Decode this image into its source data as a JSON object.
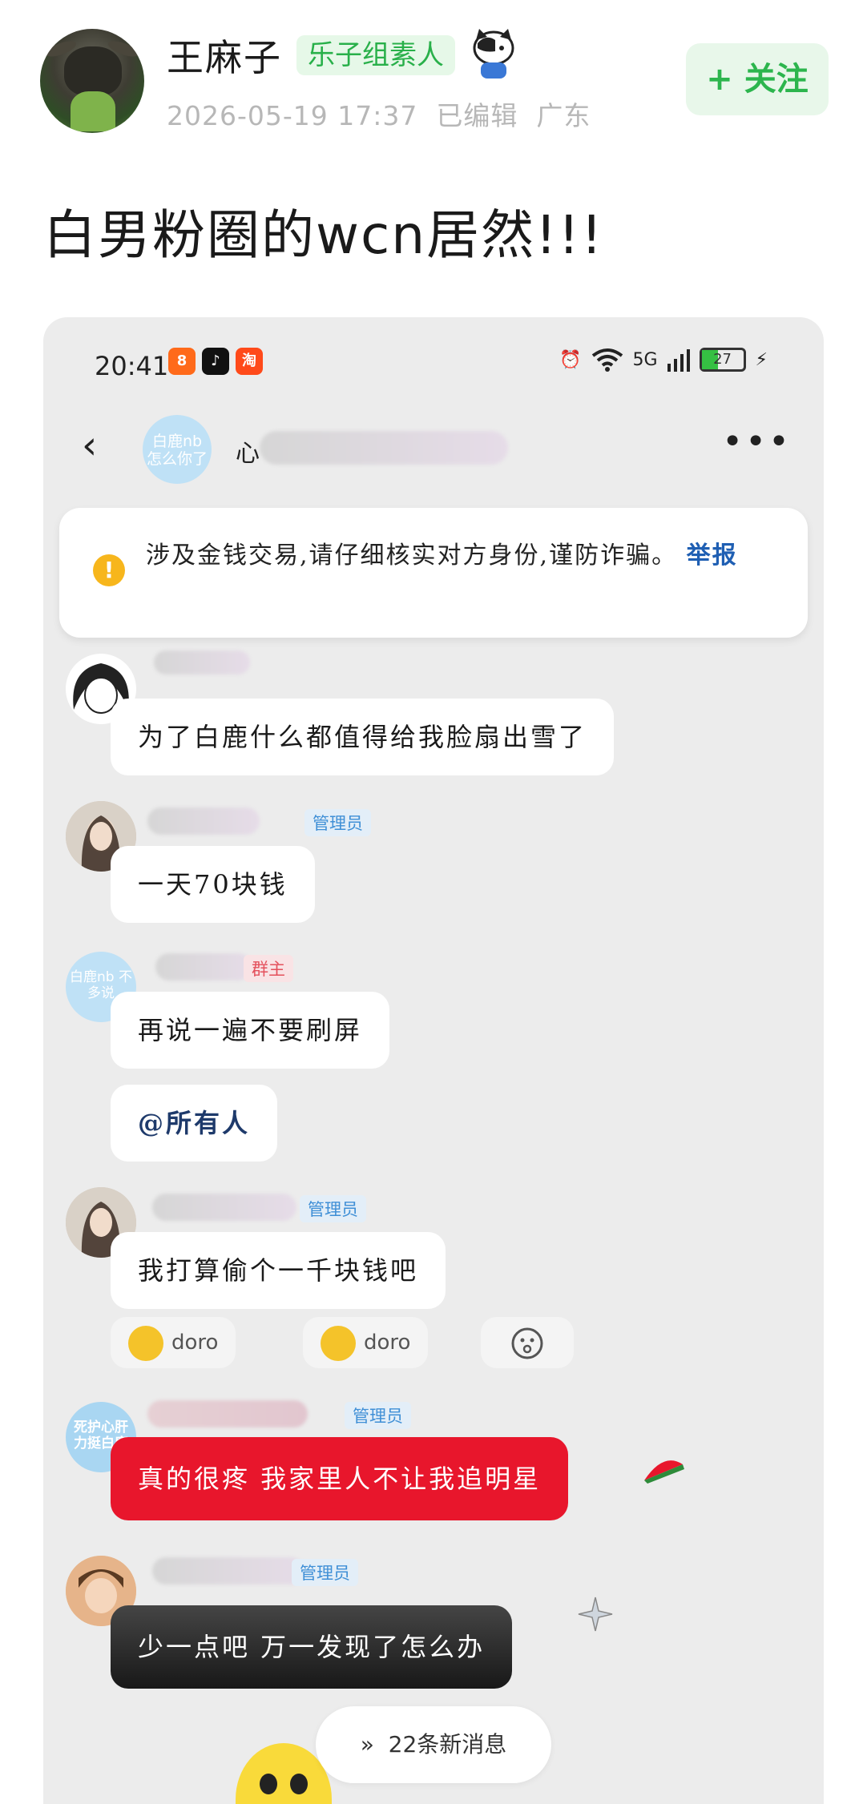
{
  "post": {
    "user_name": "王麻子",
    "user_badge": "乐子组素人",
    "timestamp": "2026-05-19 17:37",
    "edited": "已编辑",
    "location": "广东",
    "follow_label": "+ 关注",
    "title": "白男粉圈的wcn居然!!!"
  },
  "screenshot": {
    "status_time": "20:41",
    "battery": "27",
    "network": "5G",
    "chat_header": {
      "back": "‹",
      "group_avatar_text": "白鹿nb 怎么你了",
      "group_name_initial": "心",
      "more": "•••"
    },
    "warning": {
      "text": "涉及金钱交易,请仔细核实对方身份,谨防诈骗。",
      "link": "举报"
    },
    "messages": [
      {
        "role": "",
        "text": "为了白鹿什么都值得给我脸扇出雪了"
      },
      {
        "role": "管理员",
        "text": "一天70块钱"
      },
      {
        "role": "群主",
        "text": "再说一遍不要刷屏",
        "avatar_text": "白鹿nb 不多说"
      },
      {
        "text": "@所有人"
      },
      {
        "role": "管理员",
        "text": "我打算偷个一千块钱吧"
      },
      {
        "role": "管理员",
        "text": "真的很疼 我家里人不让我追明星",
        "avatar_text": "死护心肝 力挺白鹿"
      },
      {
        "role": "管理员",
        "text": "少一点吧 万一发现了怎么办"
      }
    ],
    "reactions": [
      "doro",
      "doro"
    ],
    "new_messages": "22条新消息"
  },
  "colors": {
    "green_accent": "#2cb54d",
    "admin_blue": "#3f8fd6",
    "red_bubble": "#e8162c",
    "warning_yellow": "#f7b61c"
  }
}
